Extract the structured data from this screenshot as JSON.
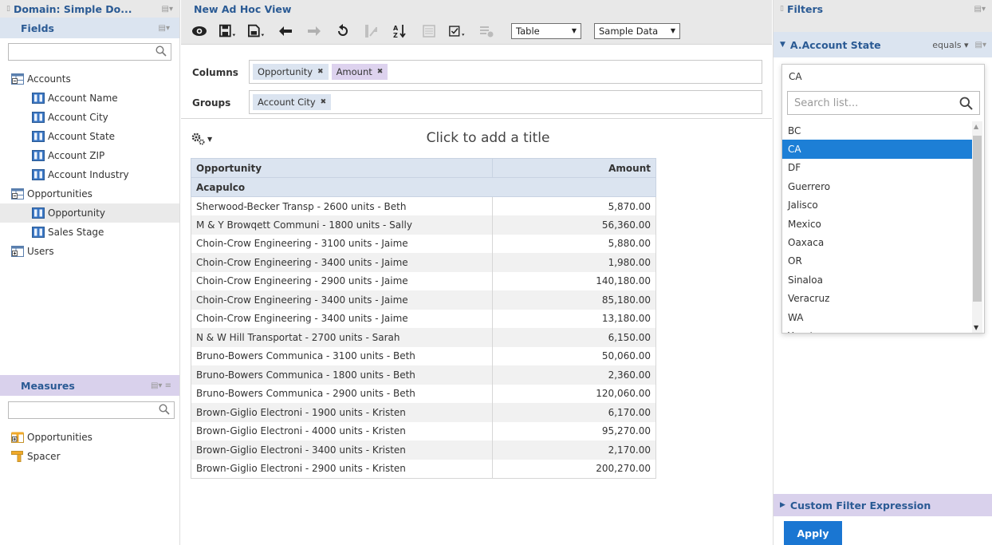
{
  "left": {
    "domain_title": "Domain: Simple Do...",
    "fields_title": "Fields",
    "tree": [
      {
        "label": "Accounts",
        "level": 0,
        "icon": "table-icon"
      },
      {
        "label": "Account Name",
        "level": 1,
        "icon": "field-icon"
      },
      {
        "label": "Account City",
        "level": 1,
        "icon": "field-icon"
      },
      {
        "label": "Account State",
        "level": 1,
        "icon": "field-icon"
      },
      {
        "label": "Account ZIP",
        "level": 1,
        "icon": "field-icon"
      },
      {
        "label": "Account Industry",
        "level": 1,
        "icon": "field-icon"
      },
      {
        "label": "Opportunities",
        "level": 0,
        "icon": "table-icon"
      },
      {
        "label": "Opportunity",
        "level": 1,
        "icon": "field-icon",
        "selected": true
      },
      {
        "label": "Sales Stage",
        "level": 1,
        "icon": "field-icon"
      },
      {
        "label": "Users",
        "level": 0,
        "icon": "table-plus-icon"
      }
    ],
    "measures_title": "Measures",
    "measures": [
      {
        "label": "Opportunities",
        "icon": "measure-folder-icon"
      },
      {
        "label": "Spacer",
        "icon": "spacer-icon"
      }
    ]
  },
  "center": {
    "title": "New Ad Hoc View",
    "view_type": "Table",
    "data_mode": "Sample Data",
    "columns_label": "Columns",
    "groups_label": "Groups",
    "columns": [
      "Opportunity",
      "Amount"
    ],
    "groups": [
      "Account City"
    ],
    "title_placeholder": "Click to add a title",
    "table": {
      "headers": [
        "Opportunity",
        "Amount"
      ],
      "group": "Acapulco",
      "rows": [
        [
          "Sherwood-Becker Transp - 2600 units - Beth",
          "5,870.00"
        ],
        [
          "M & Y Browqett Communi - 1800 units - Sally",
          "56,360.00"
        ],
        [
          "Choin-Crow Engineering - 3100 units - Jaime",
          "5,880.00"
        ],
        [
          "Choin-Crow Engineering - 3400 units - Jaime",
          "1,980.00"
        ],
        [
          "Choin-Crow Engineering - 2900 units - Jaime",
          "140,180.00"
        ],
        [
          "Choin-Crow Engineering - 3400 units - Jaime",
          "85,180.00"
        ],
        [
          "Choin-Crow Engineering - 3400 units - Jaime",
          "13,180.00"
        ],
        [
          "N & W Hill Transportat - 2700 units - Sarah",
          "6,150.00"
        ],
        [
          "Bruno-Bowers Communica - 3100 units - Beth",
          "50,060.00"
        ],
        [
          "Bruno-Bowers Communica - 1800 units - Beth",
          "2,360.00"
        ],
        [
          "Bruno-Bowers Communica - 2900 units - Beth",
          "120,060.00"
        ],
        [
          "Brown-Giglio Electroni - 1900 units - Kristen",
          "6,170.00"
        ],
        [
          "Brown-Giglio Electroni - 4000 units - Kristen",
          "95,270.00"
        ],
        [
          "Brown-Giglio Electroni - 3400 units - Kristen",
          "2,170.00"
        ],
        [
          "Brown-Giglio Electroni - 2900 units - Kristen",
          "200,270.00"
        ]
      ]
    }
  },
  "right": {
    "filters_title": "Filters",
    "filter_name": "A.Account State",
    "operator": "equals",
    "value": "CA",
    "search_placeholder": "Search list...",
    "options": [
      "BC",
      "CA",
      "DF",
      "Guerrero",
      "Jalisco",
      "Mexico",
      "Oaxaca",
      "OR",
      "Sinaloa",
      "Veracruz",
      "WA",
      "Yucatan"
    ],
    "selected_option": "CA",
    "custom_expression": "Custom Filter Expression",
    "apply_label": "Apply"
  },
  "colors": {
    "header_text": "#2a5a94",
    "blue_band": "#dbe4f0",
    "purple_band": "#d9d1ec",
    "selected_item": "#1d7fd6",
    "apply_button": "#1a76d2"
  }
}
